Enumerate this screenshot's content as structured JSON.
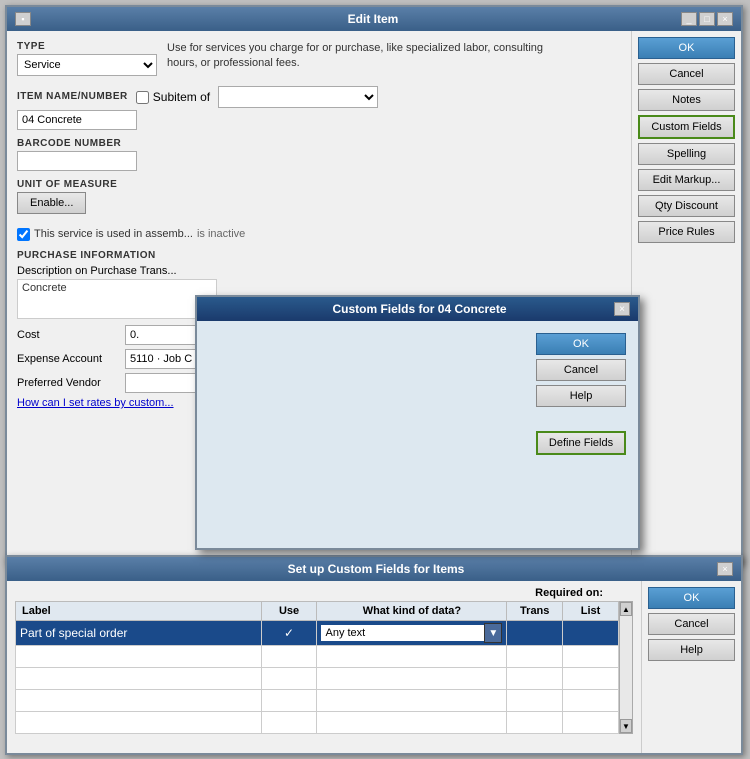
{
  "mainWindow": {
    "title": "Edit Item",
    "titlebarControls": [
      "_",
      "□",
      "×"
    ]
  },
  "type": {
    "label": "TYPE",
    "value": "Service",
    "description": "Use for services you charge for or purchase, like specialized labor, consulting hours, or professional fees."
  },
  "itemName": {
    "label": "Item Name/Number",
    "value": "04 Concrete",
    "subitemLabel": "Subitem of",
    "subitemValue": ""
  },
  "barcode": {
    "label": "Barcode Number",
    "value": ""
  },
  "unitOfMeasure": {
    "label": "UNIT OF MEASURE",
    "enableBtn": "Enable..."
  },
  "assemblyText": "This service is used in assemb...",
  "purchaseInfo": {
    "label": "PURCHASE INFORMATION",
    "descLabel": "Description on Purchase Trans...",
    "descValue": "Concrete",
    "costLabel": "Cost",
    "costValue": "0.",
    "expenseLabel": "Expense Account",
    "expenseValue": "5110 · Job C",
    "vendorLabel": "Preferred Vendor",
    "vendorValue": ""
  },
  "linkText": "How can I set rates by custom...",
  "rightButtons": {
    "ok": "OK",
    "cancel": "Cancel",
    "notes": "Notes",
    "customFields": "Custom Fields",
    "spelling": "Spelling",
    "editMarkup": "Edit Markup...",
    "qtyDiscount": "Qty Discount",
    "priceRules": "Price Rules"
  },
  "customFieldsDialog": {
    "title": "Custom Fields for 04 Concrete",
    "buttons": {
      "ok": "OK",
      "cancel": "Cancel",
      "help": "Help",
      "defineFields": "Define Fields"
    }
  },
  "setupWindow": {
    "title": "Set up Custom Fields for Items",
    "closeBtn": "×",
    "headers": {
      "label": "Label",
      "use": "Use",
      "whatKind": "What kind of data?",
      "requiredOn": "Required on:",
      "trans": "Trans",
      "list": "List"
    },
    "rows": [
      {
        "label": "Part of special order",
        "use": "✓",
        "dataType": "Any text",
        "trans": "",
        "list": ""
      },
      {
        "label": "",
        "use": "",
        "dataType": "",
        "trans": "",
        "list": ""
      },
      {
        "label": "",
        "use": "",
        "dataType": "",
        "trans": "",
        "list": ""
      },
      {
        "label": "",
        "use": "",
        "dataType": "",
        "trans": "",
        "list": ""
      },
      {
        "label": "",
        "use": "",
        "dataType": "",
        "trans": "",
        "list": ""
      }
    ],
    "buttons": {
      "ok": "OK",
      "cancel": "Cancel",
      "help": "Help"
    }
  }
}
